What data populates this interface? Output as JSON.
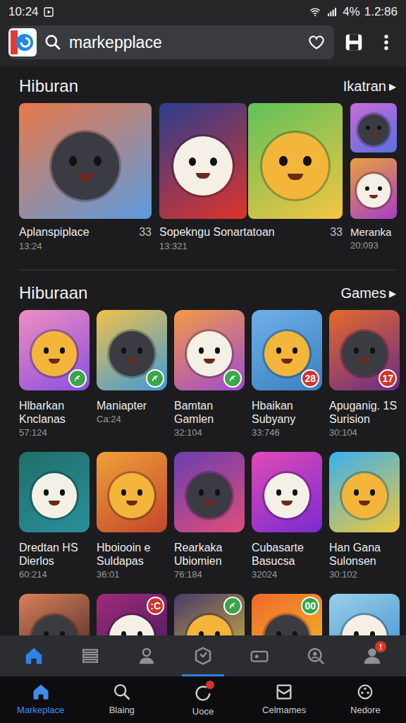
{
  "status_bar": {
    "time": "10:24",
    "battery": "4%",
    "clock": "1.2:86"
  },
  "search": {
    "query": "markepplace"
  },
  "featured": {
    "title": "Hiburan",
    "link": "Ikatran",
    "link_arrow": "▸",
    "items": [
      {
        "title": "Aplanspiplace",
        "count": "33",
        "sub": "13:24"
      },
      {
        "title": "Sopekngu Sonartatoan",
        "count": "33",
        "sub": "13:321"
      },
      {
        "title": "Meranka",
        "sub": "20:093"
      }
    ]
  },
  "games": {
    "title": "Hiburaan",
    "link": "Games",
    "link_arrow": "▸",
    "rows": [
      [
        {
          "title": "Hlbarkan Knclanas",
          "sub": "57:124",
          "badge": {
            "kind": "icon",
            "color": "#3aa64a"
          }
        },
        {
          "title": "Maniapter",
          "sub": "Ca:24",
          "badge": {
            "kind": "icon",
            "color": "#3aa64a"
          }
        },
        {
          "title": "Bamtan Gamlen",
          "sub": "32:104",
          "badge": {
            "kind": "icon",
            "color": "#3aa64a"
          }
        },
        {
          "title": "Hbaikan Subyany",
          "sub": "33:746",
          "badge": {
            "kind": "count",
            "text": "28",
            "color": "#d0352b"
          }
        },
        {
          "title": "Apuganig. 1S Surision",
          "sub": "30:104",
          "badge": {
            "kind": "count",
            "text": "17",
            "color": "#d0352b"
          }
        }
      ],
      [
        {
          "title": "Dredtan HS Dierlos",
          "sub": "60:214"
        },
        {
          "title": "Hboiooin e Suldapas",
          "sub": "36:01"
        },
        {
          "title": "Rearkaka Ubiomien",
          "sub": "76:184"
        },
        {
          "title": "Cubasarte Basucsa",
          "sub": "32024"
        },
        {
          "title": "Han Gana Sulonsen",
          "sub": "30:102"
        }
      ]
    ],
    "partial_row": [
      {},
      {
        "badge": {
          "kind": "count",
          "text": ":C",
          "color": "#d0352b"
        }
      },
      {
        "badge": {
          "kind": "icon",
          "color": "#3aa64a"
        }
      },
      {
        "badge": {
          "kind": "count",
          "text": "00",
          "color": "#2fa84a"
        }
      },
      {}
    ]
  },
  "toolbar": [
    {
      "selected": true,
      "indicator": false,
      "badge": ""
    },
    {
      "selected": false,
      "indicator": false,
      "badge": ""
    },
    {
      "selected": false,
      "indicator": false,
      "badge": ""
    },
    {
      "selected": false,
      "indicator": true,
      "badge": ""
    },
    {
      "selected": false,
      "indicator": false,
      "badge": ""
    },
    {
      "selected": false,
      "indicator": false,
      "badge": ""
    },
    {
      "selected": false,
      "indicator": false,
      "badge": "!"
    }
  ],
  "bottom_nav": [
    {
      "label": "Markeplace",
      "selected": true,
      "badge": false
    },
    {
      "label": "Blaing",
      "selected": false,
      "badge": false
    },
    {
      "label": "Uoce",
      "selected": false,
      "badge": true
    },
    {
      "label": "Celmames",
      "selected": false,
      "badge": false
    },
    {
      "label": "Nedore",
      "selected": false,
      "badge": false
    }
  ]
}
